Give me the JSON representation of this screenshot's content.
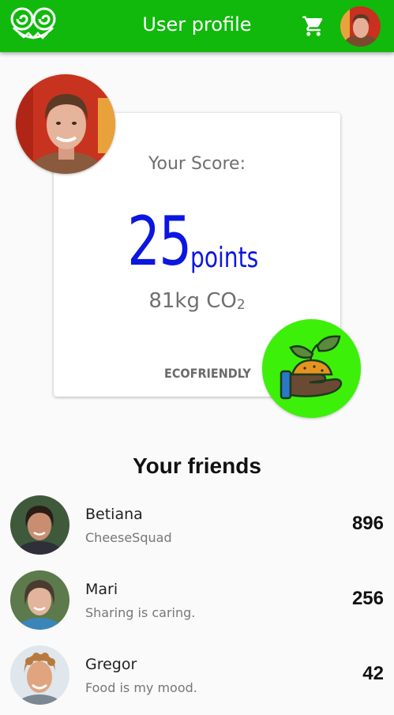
{
  "app": {
    "title": "User profile",
    "icons": {
      "logo": "frog-logo-icon",
      "cart": "cart-icon",
      "badge": "plant-in-hand-icon"
    }
  },
  "score": {
    "label": "Your Score:",
    "value": "25",
    "unit": "points",
    "co2_amount": "81kg CO",
    "co2_subscript": "2",
    "badge_label": "ECOFRIENDLY"
  },
  "friends": {
    "title": "Your friends",
    "items": [
      {
        "name": "Betiana",
        "status": "CheeseSquad",
        "points": "896"
      },
      {
        "name": "Mari",
        "status": "Sharing is caring.",
        "points": "256"
      },
      {
        "name": "Gregor",
        "status": "Food is my mood.",
        "points": "42"
      }
    ]
  },
  "colors": {
    "appbar": "#10b90b",
    "score": "#0b16e0",
    "badge_bg": "#3cf00a"
  }
}
